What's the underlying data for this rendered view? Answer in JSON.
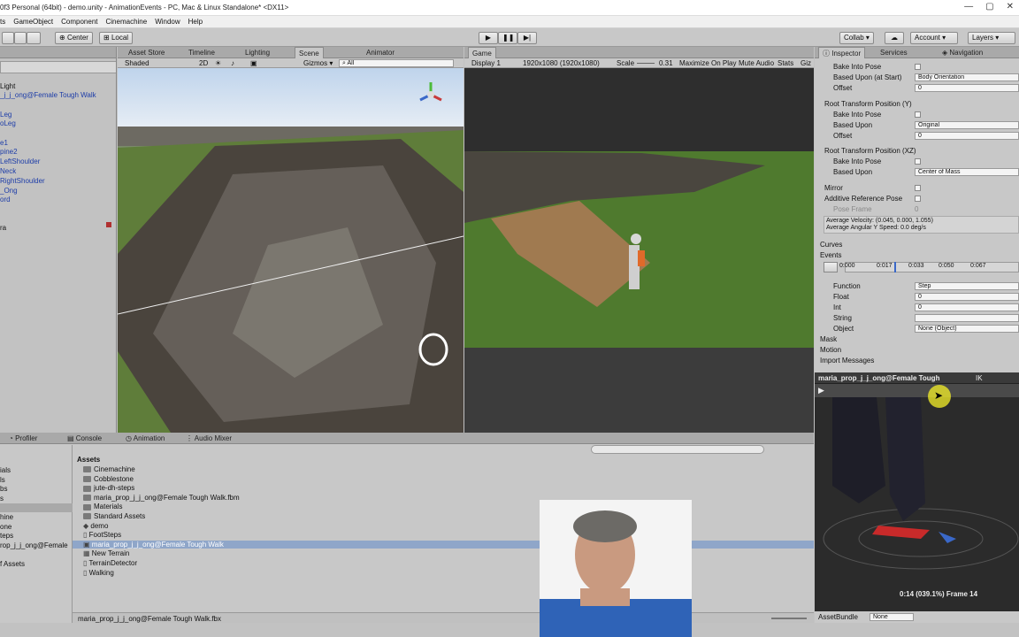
{
  "window": {
    "title": "0f3 Personal (64bit) - demo.unity - AnimationEvents - PC, Mac & Linux Standalone* <DX11>",
    "controls": [
      "—",
      "▢",
      "✕"
    ]
  },
  "menu": [
    "ts",
    "GameObject",
    "Component",
    "Cinemachine",
    "Window",
    "Help"
  ],
  "toolbar": {
    "center_label": "Center",
    "local_label": "Local",
    "collab_label": "Collab ▾",
    "account_label": "Account ▾",
    "layers_label": "Layers ▾"
  },
  "tabs_top": {
    "asset_store": "Asset Store",
    "timeline": "Timeline",
    "lighting": "Lighting",
    "scene": "Scene",
    "animator": "Animator",
    "game": "Game"
  },
  "scene_bar": {
    "shading": "Shaded",
    "mode": "2D",
    "gizmos": "Gizmos ▾",
    "search": "All"
  },
  "game_bar": {
    "display": "Display 1",
    "resolution": "1920x1080 (1920x1080)",
    "scale_label": "Scale",
    "scale_value": "0.31",
    "maximize": "Maximize On Play",
    "mute": "Mute Audio",
    "stats": "Stats",
    "gizmos": "Giz"
  },
  "hierarchy": [
    {
      "text": "Light",
      "blue": false
    },
    {
      "text": "_j_j_ong@Female Tough Walk",
      "blue": true
    },
    {
      "text": "Leg",
      "blue": true
    },
    {
      "text": "oLeg",
      "blue": true
    },
    {
      "text": "e1",
      "blue": true
    },
    {
      "text": "pine2",
      "blue": true
    },
    {
      "text": "LeftShoulder",
      "blue": true
    },
    {
      "text": "Neck",
      "blue": true
    },
    {
      "text": "RightShoulder",
      "blue": true
    },
    {
      "text": "_Ong",
      "blue": true
    },
    {
      "text": "ord",
      "blue": true
    },
    {
      "text": "ra",
      "blue": false
    }
  ],
  "inspector": {
    "tabs": [
      "Inspector",
      "Services",
      "Navigation"
    ],
    "rows_top": [
      {
        "label": "Bake Into Pose",
        "type": "check"
      },
      {
        "label": "Based Upon (at Start)",
        "type": "field",
        "value": "Body Orientation"
      },
      {
        "label": "Offset",
        "type": "field",
        "value": "0"
      }
    ],
    "section_y": "Root Transform Position (Y)",
    "rows_y": [
      {
        "label": "Bake Into Pose",
        "type": "check"
      },
      {
        "label": "Based Upon",
        "type": "field",
        "value": "Original"
      },
      {
        "label": "Offset",
        "type": "field",
        "value": "0"
      }
    ],
    "section_xz": "Root Transform Position (XZ)",
    "rows_xz": [
      {
        "label": "Bake Into Pose",
        "type": "check"
      },
      {
        "label": "Based Upon",
        "type": "field",
        "value": "Center of Mass"
      }
    ],
    "mirror": "Mirror",
    "additive": "Additive Reference Pose",
    "pose_frame": "Pose Frame",
    "pose_frame_value": "0",
    "avg_velocity": "Average Velocity: (0.045, 0.000, 1.055)",
    "avg_angular": "Average Angular Y Speed: 0.0 deg/s",
    "curves": "Curves",
    "events": "Events",
    "timeline_ticks": [
      "0:000",
      "0:017",
      "0:033",
      "0:050",
      "0:067"
    ],
    "function_label": "Function",
    "function_value": "Step",
    "float_label": "Float",
    "float_value": "0",
    "int_label": "Int",
    "int_value": "0",
    "string_label": "String",
    "string_value": "",
    "object_label": "Object",
    "object_value": "None (Object)",
    "mask": "Mask",
    "motion": "Motion",
    "import_messages": "Import Messages"
  },
  "preview": {
    "title": "maria_prop_j_j_ong@Female Tough",
    "ik": "IK",
    "frame": "0:14 (039.1%) Frame 14",
    "assetbundle": "AssetBundle",
    "assetbundle_value": "None"
  },
  "bottom_tabs": {
    "profiler": "Profiler",
    "console": "Console",
    "animation": "Animation",
    "audio_mixer": "Audio Mixer"
  },
  "project_left": [
    "ials",
    "ls",
    "bs",
    "s",
    "",
    "hine",
    "one",
    "teps",
    "rop_j_j_ong@Female",
    "",
    "f Assets"
  ],
  "assets_header": "Assets",
  "assets": [
    {
      "name": "Cinemachine",
      "kind": "folder"
    },
    {
      "name": "Cobblestone",
      "kind": "folder"
    },
    {
      "name": "jute-dh-steps",
      "kind": "folder"
    },
    {
      "name": "maria_prop_j_j_ong@Female Tough Walk.fbm",
      "kind": "folder"
    },
    {
      "name": "Materials",
      "kind": "folder"
    },
    {
      "name": "Standard Assets",
      "kind": "folder"
    },
    {
      "name": "demo",
      "kind": "unity"
    },
    {
      "name": "FootSteps",
      "kind": "script"
    },
    {
      "name": "maria_prop_j_j_ong@Female Tough Walk",
      "kind": "model"
    },
    {
      "name": "New Terrain",
      "kind": "terrain"
    },
    {
      "name": "TerrainDetector",
      "kind": "script"
    },
    {
      "name": "Walking",
      "kind": "script"
    }
  ],
  "status_path": "maria_prop_j_j_ong@Female Tough Walk.fbx",
  "colors": {
    "panel": "#c8c8c8",
    "selected_row": "#8fa6c9",
    "link_blue": "#1d3da8"
  }
}
